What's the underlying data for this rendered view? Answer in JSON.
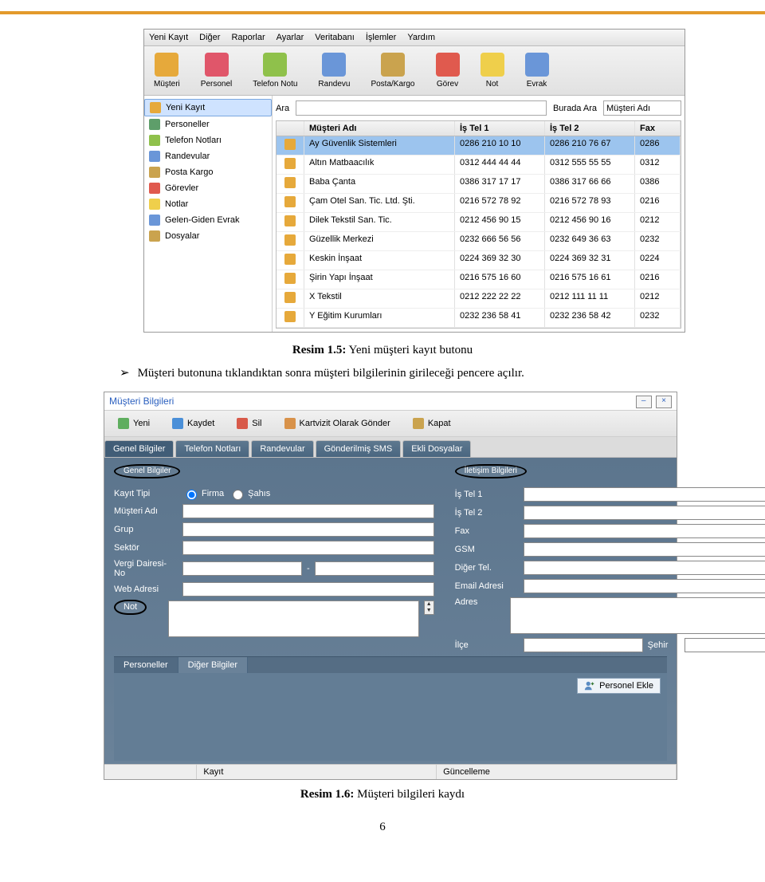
{
  "menubar": {
    "items": [
      "Yeni Kayıt",
      "Diğer",
      "Raporlar",
      "Ayarlar",
      "Veritabanı",
      "İşlemler",
      "Yardım"
    ]
  },
  "toolbar": {
    "items": [
      {
        "label": "Müşteri",
        "icon": "#e6a93b"
      },
      {
        "label": "Personel",
        "icon": "#e0566a"
      },
      {
        "label": "Telefon Notu",
        "icon": "#8fc14b"
      },
      {
        "label": "Randevu",
        "icon": "#6a96d8"
      },
      {
        "label": "Posta/Kargo",
        "icon": "#caa34e"
      },
      {
        "label": "Görev",
        "icon": "#e05a4e"
      },
      {
        "label": "Not",
        "icon": "#efcf4b"
      },
      {
        "label": "Evrak",
        "icon": "#6a96d8"
      }
    ]
  },
  "sidebar": {
    "items": [
      {
        "label": "Yeni Kayıt",
        "icon": "#e6a93b",
        "selected": true
      },
      {
        "label": "Personeller",
        "icon": "#5e9e6a"
      },
      {
        "label": "Telefon Notları",
        "icon": "#8fc14b"
      },
      {
        "label": "Randevular",
        "icon": "#6a96d8"
      },
      {
        "label": "Posta Kargo",
        "icon": "#caa34e"
      },
      {
        "label": "Görevler",
        "icon": "#e05a4e"
      },
      {
        "label": "Notlar",
        "icon": "#efcf4b"
      },
      {
        "label": "Gelen-Giden Evrak",
        "icon": "#6a96d8"
      },
      {
        "label": "Dosyalar",
        "icon": "#caa34e"
      }
    ]
  },
  "search": {
    "ara_label": "Ara",
    "burada_label": "Burada Ara",
    "burada_value": "Müşteri Adı"
  },
  "grid": {
    "headers": [
      "",
      "Müşteri Adı",
      "İş Tel 1",
      "İş Tel 2",
      "Fax"
    ],
    "rows": [
      {
        "name": "Ay Güvenlik Sistemleri",
        "t1": "0286 210 10 10",
        "t2": "0286 210 76 67",
        "fx": "0286",
        "sel": true
      },
      {
        "name": "Altın Matbaacılık",
        "t1": "0312 444 44 44",
        "t2": "0312 555 55 55",
        "fx": "0312"
      },
      {
        "name": "Baba Çanta",
        "t1": "0386 317 17 17",
        "t2": "0386 317 66 66",
        "fx": "0386"
      },
      {
        "name": "Çam Otel San. Tic. Ltd. Şti.",
        "t1": "0216 572 78 92",
        "t2": "0216 572 78 93",
        "fx": "0216"
      },
      {
        "name": "Dilek Tekstil San. Tic.",
        "t1": "0212 456 90 15",
        "t2": "0212 456 90 16",
        "fx": "0212"
      },
      {
        "name": "Güzellik Merkezi",
        "t1": "0232 666 56 56",
        "t2": "0232 649 36 63",
        "fx": "0232"
      },
      {
        "name": "Keskin İnşaat",
        "t1": "0224 369 32 30",
        "t2": "0224 369 32 31",
        "fx": "0224"
      },
      {
        "name": "Şirin Yapı İnşaat",
        "t1": "0216 575 16 60",
        "t2": "0216 575 16 61",
        "fx": "0216"
      },
      {
        "name": "X Tekstil",
        "t1": "0212 222 22 22",
        "t2": "0212 111 11 11",
        "fx": "0212"
      },
      {
        "name": "Y Eğitim Kurumları",
        "t1": "0232 236 58 41",
        "t2": "0232 236 58 42",
        "fx": "0232"
      }
    ]
  },
  "caption1": {
    "bold": "Resim 1.5:",
    "rest": " Yeni müşteri kayıt butonu"
  },
  "bodytext": "Müşteri butonuna tıklandıktan sonra müşteri bilgilerinin girileceği pencere açılır.",
  "dialog": {
    "title": "Müşteri Bilgileri",
    "toolbar": [
      {
        "label": "Yeni",
        "icon": "#5fae5f"
      },
      {
        "label": "Kaydet",
        "icon": "#4a8fd8"
      },
      {
        "label": "Sil",
        "icon": "#d85a4a"
      },
      {
        "label": "Kartvizit Olarak Gönder",
        "icon": "#d8924a"
      },
      {
        "label": "Kapat",
        "icon": "#caa34e"
      }
    ],
    "tabs": [
      "Genel Bilgiler",
      "Telefon Notları",
      "Randevular",
      "Gönderilmiş SMS",
      "Ekli Dosyalar"
    ],
    "group_general": "Genel Bilgiler",
    "group_contact": "İletişim Bilgileri",
    "left_labels": {
      "kayit": "Kayıt Tipi",
      "firma": "Firma",
      "sahis": "Şahıs",
      "musteri": "Müşteri Adı",
      "grup": "Grup",
      "sektor": "Sektör",
      "vergi": "Vergi Dairesi-No",
      "web": "Web Adresi",
      "not": "Not"
    },
    "right_labels": {
      "istel1": "İş Tel 1",
      "istel2": "İş Tel 2",
      "fax": "Fax",
      "gsm": "GSM",
      "diger": "Diğer Tel.",
      "email": "Email Adresi",
      "adres": "Adres",
      "ilce": "İlçe",
      "sehir": "Şehir"
    },
    "subtabs": [
      "Personeller",
      "Diğer Bilgiler"
    ],
    "personel_ekle": "Personel Ekle",
    "status": {
      "kayit": "Kayıt",
      "guncel": "Güncelleme"
    }
  },
  "caption2": {
    "bold": "Resim 1.6:",
    "rest": " Müşteri bilgileri kaydı"
  },
  "page_number": "6"
}
